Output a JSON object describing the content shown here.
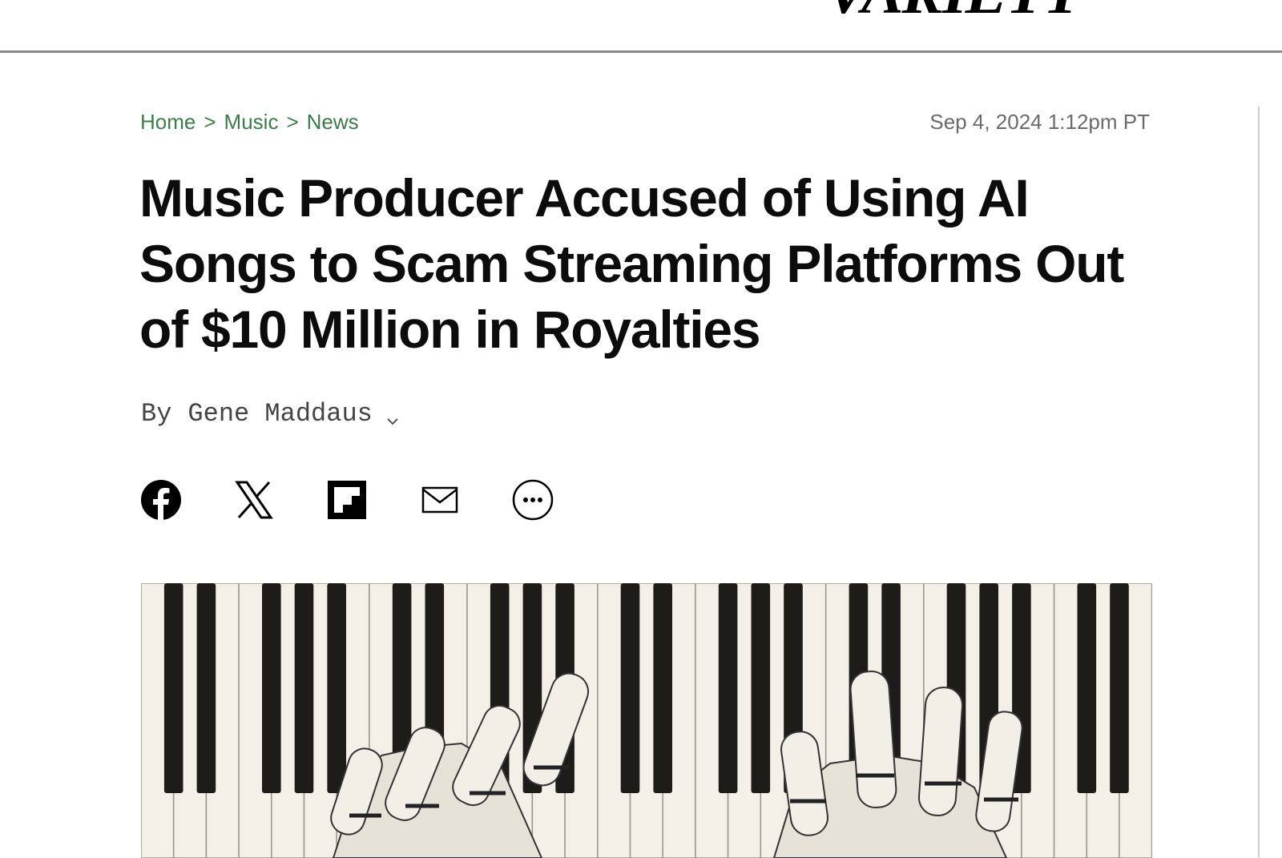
{
  "site": {
    "logo": "VARIETY"
  },
  "breadcrumb": {
    "items": [
      "Home",
      "Music",
      "News"
    ],
    "separator": ">"
  },
  "article": {
    "timestamp": "Sep 4, 2024 1:12pm PT",
    "headline": "Music Producer Accused of Using AI Songs to Scam Streaming Platforms Out of $10 Million in Royalties",
    "byline_prefix": "By",
    "author": "Gene Maddaus"
  },
  "share": {
    "icons": [
      "facebook-icon",
      "x-icon",
      "flipboard-icon",
      "email-icon",
      "more-icon"
    ]
  },
  "hero_image": {
    "subject": "robot hands playing piano keys"
  },
  "colors": {
    "breadcrumb": "#3b7d4a",
    "headline": "#0c0c0c",
    "timestamp": "#6b6b6b"
  }
}
